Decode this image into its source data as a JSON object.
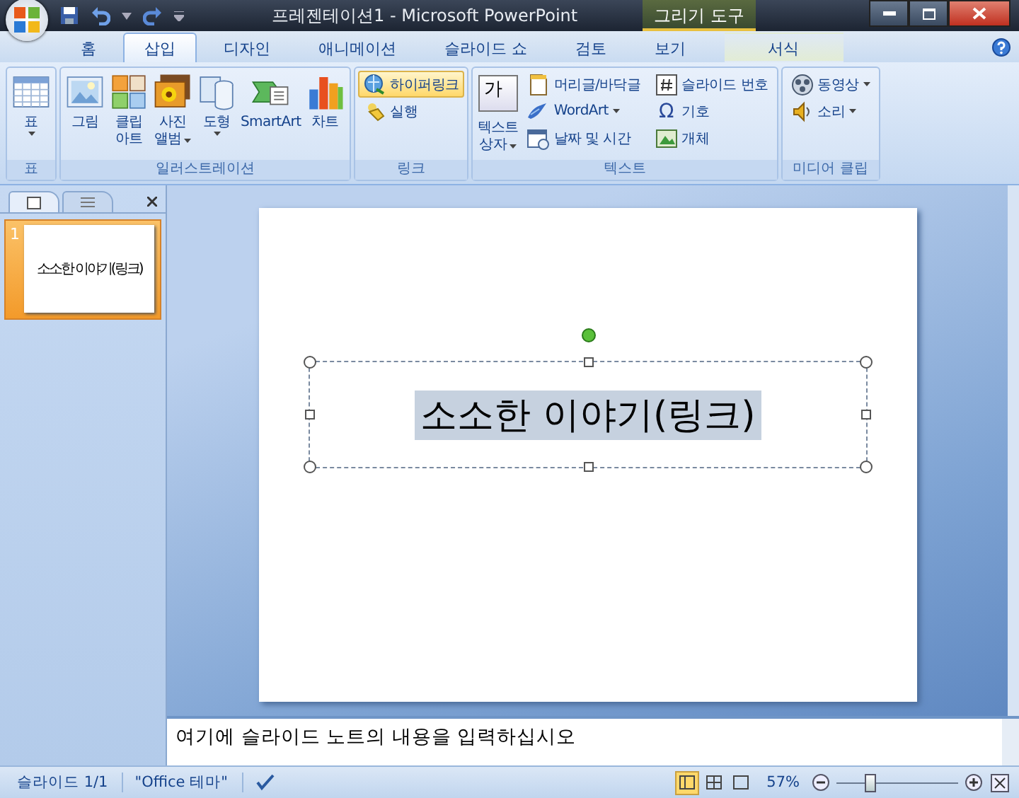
{
  "window": {
    "title": "프레젠테이션1 - Microsoft PowerPoint",
    "contextual_group": "그리기 도구"
  },
  "tabs": [
    {
      "label": "홈",
      "selected": false,
      "kind": "normal"
    },
    {
      "label": "삽입",
      "selected": true,
      "kind": "normal"
    },
    {
      "label": "디자인",
      "selected": false,
      "kind": "normal"
    },
    {
      "label": "애니메이션",
      "selected": false,
      "kind": "normal"
    },
    {
      "label": "슬라이드 쇼",
      "selected": false,
      "kind": "normal"
    },
    {
      "label": "검토",
      "selected": false,
      "kind": "normal"
    },
    {
      "label": "보기",
      "selected": false,
      "kind": "normal"
    },
    {
      "label": "서식",
      "selected": false,
      "kind": "contextual"
    }
  ],
  "ribbon": {
    "groups": [
      {
        "label": "표",
        "items": [
          {
            "kind": "large",
            "lines": [
              "표"
            ],
            "dropdown": true
          }
        ]
      },
      {
        "label": "일러스트레이션",
        "items": [
          {
            "kind": "large",
            "lines": [
              "그림"
            ],
            "dropdown": false
          },
          {
            "kind": "large",
            "lines": [
              "클립",
              "아트"
            ],
            "dropdown": false
          },
          {
            "kind": "large",
            "lines": [
              "사진",
              "앨범"
            ],
            "dropdown": true
          },
          {
            "kind": "large",
            "lines": [
              "도형"
            ],
            "dropdown": true
          },
          {
            "kind": "large",
            "lines": [
              "SmartArt"
            ],
            "dropdown": false
          },
          {
            "kind": "large",
            "lines": [
              "차트"
            ],
            "dropdown": false
          }
        ]
      },
      {
        "label": "링크",
        "items": [
          {
            "kind": "small",
            "label": "하이퍼링크",
            "dropdown": false,
            "highlighted": true
          },
          {
            "kind": "small",
            "label": "실행",
            "dropdown": false,
            "highlighted": false
          }
        ]
      },
      {
        "label": "텍스트",
        "items": [
          {
            "kind": "large",
            "lines": [
              "텍스트",
              "상자"
            ],
            "dropdown": true,
            "icon_text": "가"
          },
          {
            "kind": "small",
            "label": "머리글/바닥글",
            "dropdown": false,
            "highlighted": false
          },
          {
            "kind": "small",
            "label": "WordArt",
            "dropdown": true,
            "highlighted": false
          },
          {
            "kind": "small",
            "label": "날짜 및 시간",
            "dropdown": false,
            "highlighted": false
          },
          {
            "kind": "small",
            "label": "슬라이드 번호",
            "dropdown": false,
            "highlighted": false
          },
          {
            "kind": "small",
            "label": "기호",
            "dropdown": false,
            "highlighted": false,
            "icon_text": "Ω"
          },
          {
            "kind": "small",
            "label": "개체",
            "dropdown": false,
            "highlighted": false
          }
        ]
      },
      {
        "label": "미디어 클립",
        "items": [
          {
            "kind": "small",
            "label": "동영상",
            "dropdown": true,
            "highlighted": false
          },
          {
            "kind": "small",
            "label": "소리",
            "dropdown": true,
            "highlighted": false
          }
        ]
      }
    ]
  },
  "slides_panel": {
    "slides": [
      {
        "number": "1",
        "title": "소소한 이야기(링크)",
        "selected": true
      }
    ]
  },
  "slide": {
    "title": "소소한 이야기(링크)",
    "title_selected": true
  },
  "notes": {
    "placeholder": "여기에 슬라이드 노트의 내용을 입력하십시오"
  },
  "status_bar": {
    "slide": "슬라이드 1/1",
    "theme": "\"Office 테마\"",
    "views": [
      {
        "selected": true
      },
      {
        "selected": false
      },
      {
        "selected": false
      }
    ],
    "zoom": "57%",
    "zoom_slider": {
      "level": 0.28
    }
  }
}
